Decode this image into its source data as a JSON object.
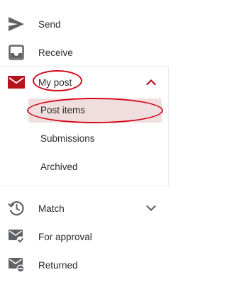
{
  "colors": {
    "accent": "#b5121b",
    "icon_gray": "#5f6368",
    "annotation": "#d6081c",
    "active_bg": "#f0dede"
  },
  "nav": {
    "send": {
      "label": "Send",
      "icon": "send-icon"
    },
    "receive": {
      "label": "Receive",
      "icon": "inbox-icon"
    },
    "my_post": {
      "label": "My post",
      "icon": "mail-icon",
      "expanded": true,
      "chevron": "chevron-up-icon",
      "items": [
        {
          "label": "Post items",
          "active": true
        },
        {
          "label": "Submissions",
          "active": false
        },
        {
          "label": "Archived",
          "active": false
        }
      ]
    },
    "match": {
      "label": "Match",
      "icon": "clock-history-icon",
      "chevron": "chevron-down-icon"
    },
    "for_approval": {
      "label": "For approval",
      "icon": "mail-check-icon"
    },
    "returned": {
      "label": "Returned",
      "icon": "mail-return-icon"
    }
  }
}
